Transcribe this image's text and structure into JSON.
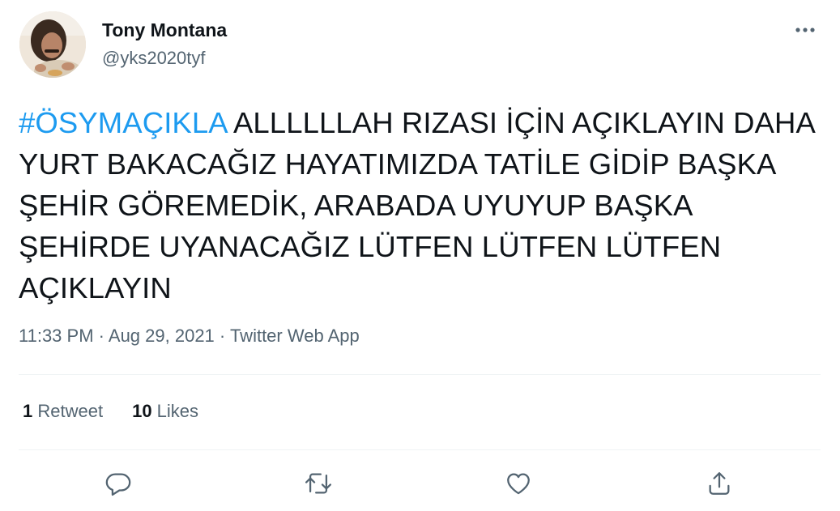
{
  "user": {
    "name": "Tony Montana",
    "handle": "@yks2020tyf"
  },
  "tweet": {
    "hashtag": "#ÖSYMAÇIKLA",
    "text": " ALLLLLLAH RIZASI İÇİN AÇIKLAYIN DAHA YURT BAKACAĞIZ HAYATIMIZDA TATİLE GİDİP BAŞKA ŞEHİR GÖREMEDİK, ARABADA UYUYUP BAŞKA ŞEHİRDE UYANACAĞIZ LÜTFEN LÜTFEN LÜTFEN AÇIKLAYIN"
  },
  "meta": {
    "time": "11:33 PM",
    "separator": " · ",
    "date": "Aug 29, 2021",
    "source": "Twitter Web App"
  },
  "stats": {
    "retweets_count": "1",
    "retweets_label": " Retweet",
    "likes_count": "10",
    "likes_label": " Likes"
  },
  "icons": {
    "more": "more-horizontal-icon",
    "reply": "reply-icon",
    "retweet": "retweet-icon",
    "like": "heart-icon",
    "share": "share-icon"
  },
  "colors": {
    "link": "#1d9bf0",
    "secondary_text": "#536471",
    "primary_text": "#0f1419",
    "divider": "#eff3f4"
  }
}
